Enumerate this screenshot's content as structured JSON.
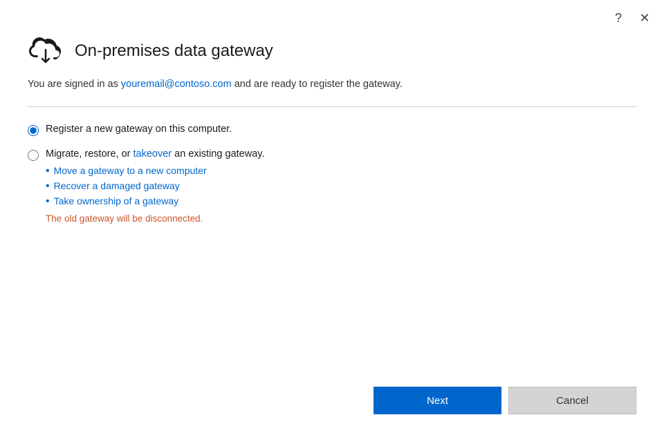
{
  "titleBar": {
    "helpIcon": "?",
    "closeIcon": "✕"
  },
  "header": {
    "title": "On-premises data gateway"
  },
  "subtitle": {
    "prefix": "You are signed in as ",
    "email": "youremail@contoso.com",
    "suffix": " and are ready to register the gateway."
  },
  "options": {
    "option1": {
      "label": "Register a new gateway on this computer.",
      "selected": true
    },
    "option2": {
      "label_prefix": "Migrate, restore, or ",
      "label_link": "takeover",
      "label_suffix": " an existing gateway.",
      "selected": false,
      "bullets": [
        "Move a gateway to a new computer",
        "Recover a damaged gateway",
        "Take ownership of a gateway"
      ],
      "note": "The old gateway will be disconnected."
    }
  },
  "footer": {
    "nextButton": "Next",
    "cancelButton": "Cancel"
  }
}
